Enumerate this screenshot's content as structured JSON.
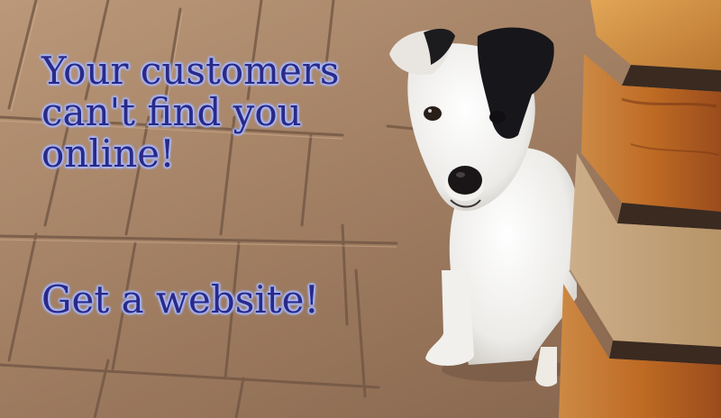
{
  "banner": {
    "headline_lines": [
      "Your customers",
      "can't find you",
      "online!"
    ],
    "cta": "Get a website!",
    "colors": {
      "text": "#2a2a86",
      "text_glow": "#a9b9ff",
      "pavement": "#a88466",
      "brick": "#c4792c"
    },
    "image_subject": "dog-beside-brick-stack-on-paving"
  }
}
